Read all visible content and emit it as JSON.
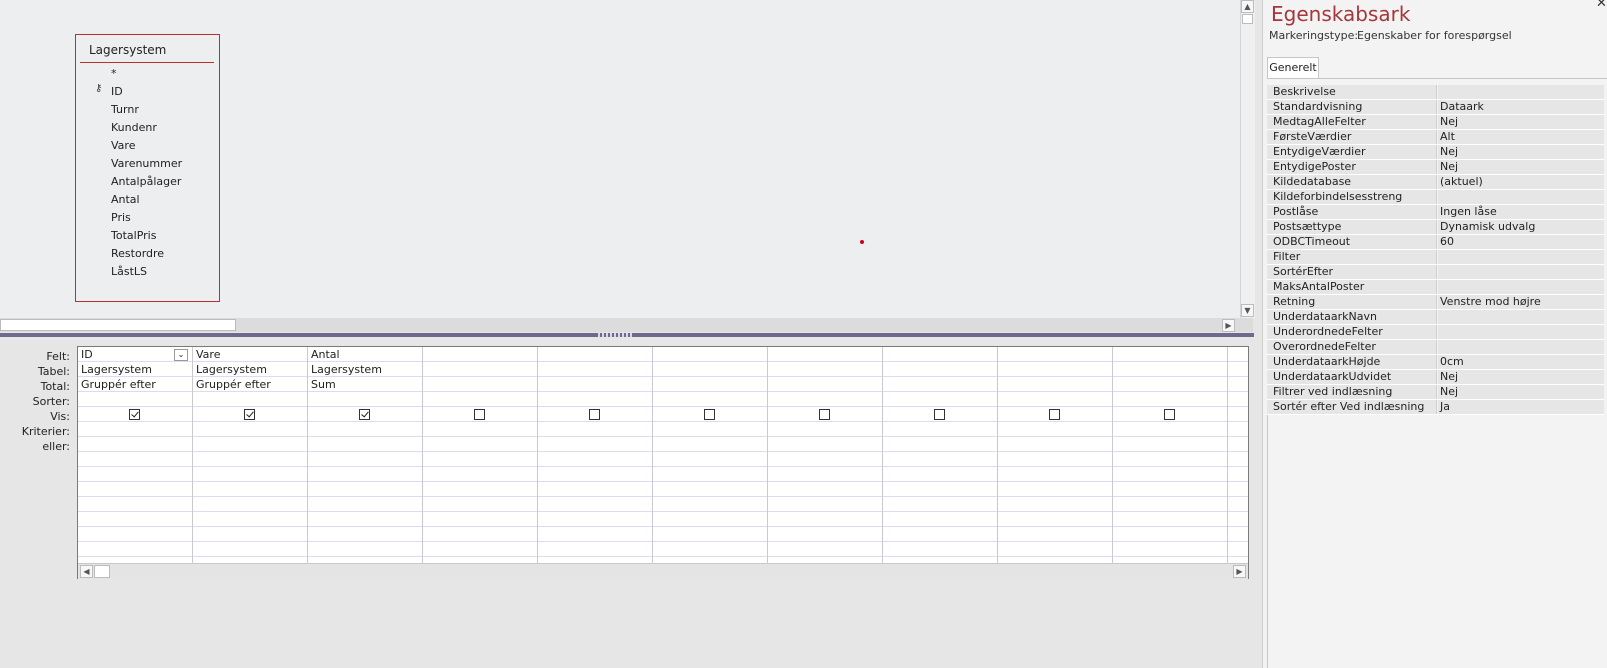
{
  "table": {
    "title": "Lagersystem",
    "fields": [
      "*",
      "ID",
      "Turnr",
      "Kundenr",
      "Vare",
      "Varenummer",
      "Antalpålager",
      "Antal",
      "Pris",
      "TotalPris",
      "Restordre",
      "LåstLS"
    ],
    "key_field": "ID",
    "key_icon": "key-icon"
  },
  "grid": {
    "row_labels": [
      "Felt:",
      "Tabel:",
      "Total:",
      "Sorter:",
      "Vis:",
      "Kriterier:",
      "eller:"
    ],
    "columns": [
      {
        "felt": "ID",
        "tabel": "Lagersystem",
        "total": "Gruppér efter",
        "vis": true
      },
      {
        "felt": "Vare",
        "tabel": "Lagersystem",
        "total": "Gruppér efter",
        "vis": true
      },
      {
        "felt": "Antal",
        "tabel": "Lagersystem",
        "total": "Sum",
        "vis": true
      },
      {
        "felt": "",
        "tabel": "",
        "total": "",
        "vis": false
      },
      {
        "felt": "",
        "tabel": "",
        "total": "",
        "vis": false
      },
      {
        "felt": "",
        "tabel": "",
        "total": "",
        "vis": false
      },
      {
        "felt": "",
        "tabel": "",
        "total": "",
        "vis": false
      },
      {
        "felt": "",
        "tabel": "",
        "total": "",
        "vis": false
      },
      {
        "felt": "",
        "tabel": "",
        "total": "",
        "vis": false
      },
      {
        "felt": "",
        "tabel": "",
        "total": "",
        "vis": false
      }
    ]
  },
  "property_sheet": {
    "title": "Egenskabsark",
    "selection_label": "Markeringstype:",
    "selection_value": "Egenskaber for forespørgsel",
    "tab": "Generelt",
    "properties": [
      {
        "name": "Beskrivelse",
        "value": ""
      },
      {
        "name": "Standardvisning",
        "value": "Dataark"
      },
      {
        "name": "MedtagAlleFelter",
        "value": "Nej"
      },
      {
        "name": "FørsteVærdier",
        "value": "Alt"
      },
      {
        "name": "EntydigeVærdier",
        "value": "Nej"
      },
      {
        "name": "EntydigePoster",
        "value": "Nej"
      },
      {
        "name": "Kildedatabase",
        "value": "(aktuel)"
      },
      {
        "name": "Kildeforbindelsesstreng",
        "value": ""
      },
      {
        "name": "Postlåse",
        "value": "Ingen låse"
      },
      {
        "name": "Postsættype",
        "value": "Dynamisk udvalg"
      },
      {
        "name": "ODBCTimeout",
        "value": "60"
      },
      {
        "name": "Filter",
        "value": ""
      },
      {
        "name": "SortérEfter",
        "value": ""
      },
      {
        "name": "MaksAntalPoster",
        "value": ""
      },
      {
        "name": "Retning",
        "value": "Venstre mod højre"
      },
      {
        "name": "UnderdataarkNavn",
        "value": ""
      },
      {
        "name": "UnderordnedeFelter",
        "value": ""
      },
      {
        "name": "OverordnedeFelter",
        "value": ""
      },
      {
        "name": "UnderdataarkHøjde",
        "value": "0cm"
      },
      {
        "name": "UnderdataarkUdvidet",
        "value": "Nej"
      },
      {
        "name": "Filtrer ved indlæsning",
        "value": "Nej"
      },
      {
        "name": "Sortér efter Ved indlæsning",
        "value": "Ja"
      }
    ]
  },
  "colors": {
    "accent": "#a4373a",
    "table_border": "#b9312e",
    "splitter": "#6e6a8e"
  }
}
